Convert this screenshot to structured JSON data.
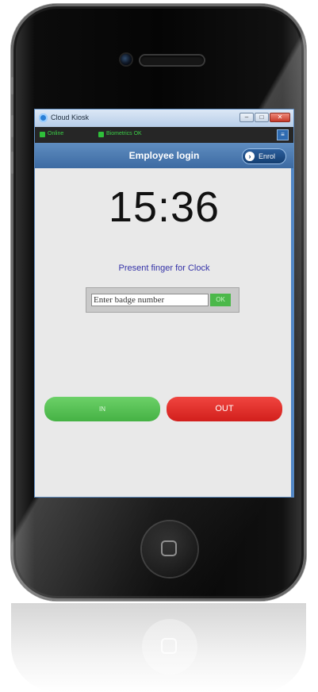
{
  "window": {
    "title": "Cloud Kiosk",
    "controls": {
      "minimize": "–",
      "maximize": "□",
      "close": "✕"
    }
  },
  "statusbar": {
    "online_label": "Online",
    "biometrics_label": "Biometrics OK",
    "menu_button": "≡"
  },
  "header": {
    "title": "Employee login",
    "enrol_label": "Enrol",
    "enrol_icon": "›"
  },
  "clock": {
    "time": "15:36"
  },
  "prompt": {
    "text": "Present finger for Clock"
  },
  "badge": {
    "placeholder": "Enter badge number",
    "ok_label": "OK"
  },
  "actions": {
    "in_label": "IN",
    "out_label": "OUT"
  },
  "colors": {
    "accent": "#3c6aa2",
    "status_ok": "#2fbf3a",
    "in": "#4bb84a",
    "out": "#d21f1c",
    "prompt": "#3533a8"
  },
  "icons": [
    "camera-icon",
    "speaker-grille",
    "home-button-icon",
    "app-icon",
    "chevron-right-icon"
  ]
}
